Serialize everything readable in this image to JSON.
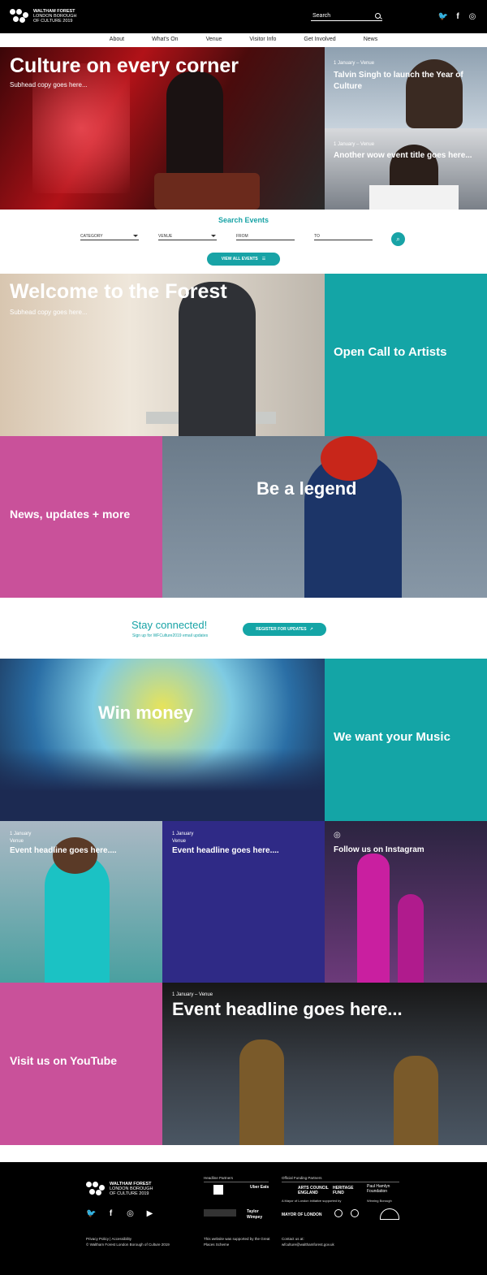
{
  "header": {
    "logo_line1": "WALTHAM FOREST",
    "logo_line2": "LONDON BOROUGH",
    "logo_line3": "OF CULTURE 2019",
    "search_placeholder": "Search"
  },
  "nav": [
    "About",
    "What's On",
    "Venue",
    "Visitor Info",
    "Get Involved",
    "News"
  ],
  "hero": {
    "title": "Culture on every corner",
    "subtitle": "Subhead copy goes here...",
    "side1_meta": "1 January – Venue",
    "side1_title": "Talvin Singh to launch the Year of Culture",
    "side2_meta": "1 January – Venue",
    "side2_title": "Another wow event title goes here..."
  },
  "search_events": {
    "title": "Search Events",
    "category": "CATEGORY",
    "venue": "VENUE",
    "from": "FROM",
    "to": "TO",
    "view_all": "VIEW ALL EVENTS"
  },
  "tiles": {
    "welcome_title": "Welcome to the Forest",
    "welcome_sub": "Subhead copy goes here...",
    "open_call": "Open Call to Artists",
    "news": "News, updates + more",
    "legend": "Be a legend",
    "win_money": "Win money",
    "music": "We want your Music",
    "event1_date": "1 January",
    "event1_venue": "Venue",
    "event1_title": "Event headline goes here....",
    "event2_date": "1 January",
    "event2_venue": "Venue",
    "event2_title": "Event headline goes here....",
    "instagram": "Follow us on Instagram",
    "youtube": "Visit us on YouTube",
    "big_meta": "1 January – Venue",
    "big_title": "Event headline goes here..."
  },
  "stay": {
    "title": "Stay connected!",
    "sub": "Sign up for WFCulture2019 email updates",
    "button": "REGISTER FOR UPDATES"
  },
  "footer": {
    "logo_line1": "WALTHAM FOREST",
    "logo_line2": "LONDON BOROUGH",
    "logo_line3": "OF CULTURE 2019",
    "headline_partners": "Headline Partners",
    "funding_partners": "Official Funding Partners",
    "mayor_note": "A Mayor of London initiative supported by",
    "winning_borough": "Winning Borough",
    "legal1": "Privacy Policy",
    "legal2": "Accessibility",
    "copyright": "© Waltham Forest London Borough of Culture 2019",
    "supported": "This website was supported by the Great Places Scheme",
    "contact_label": "Contact us at:",
    "contact_email": "wfculture@walthamforest.gov.uk",
    "uber": "Uber Eats",
    "taylor": "Taylor Wimpey",
    "arts": "ARTS COUNCIL ENGLAND",
    "heritage": "HERITAGE FUND",
    "hamlyn": "Paul Hamlyn Foundation",
    "mayor": "MAYOR OF LONDON"
  }
}
